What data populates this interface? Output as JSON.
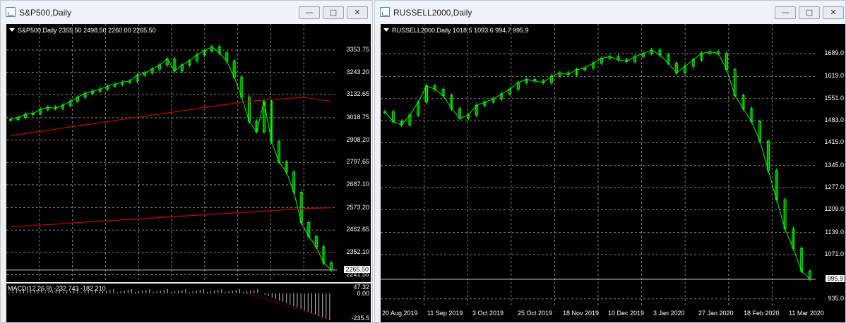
{
  "left_window": {
    "title": "S&P500,Daily",
    "header": "S&P500,Daily  2355.50 2498.50 2260.00 2265.50",
    "macd_label": "MACD(12,26,9) -232.743 -182.210",
    "macd_y_labels": [
      "47.32",
      "0.00",
      "-235.5"
    ],
    "current_price_label": "2265.50",
    "buttons": [
      "minimize",
      "restore",
      "close"
    ]
  },
  "right_window": {
    "title": "RUSSELL2000,Daily",
    "header": "RUSSELL2000,Daily  1018.5 1093.6 994.7 995.9",
    "current_price_label": "995.9",
    "buttons": [
      "minimize",
      "restore",
      "close"
    ]
  },
  "colors": {
    "bull": "#00ff00",
    "bear": "#00ff00",
    "ma": "#d00000",
    "grid": "#808080",
    "background": "#000000"
  },
  "chart_data": [
    {
      "type": "line",
      "title": "S&P500,Daily",
      "ylabel": "",
      "xlabel": "",
      "ylim": [
        2240,
        3420
      ],
      "y_ticks": [
        3353.75,
        3243.2,
        3132.65,
        3018.75,
        2908.2,
        2797.65,
        2687.1,
        2573.2,
        2462.65,
        2352.1,
        2241.55
      ],
      "x": [
        0,
        4,
        8,
        12,
        16,
        20,
        24,
        28,
        32,
        36,
        40,
        44,
        48,
        52,
        56,
        60,
        64,
        68,
        72,
        76,
        80,
        84,
        88,
        92,
        96,
        100,
        104,
        108,
        110,
        112,
        114,
        116,
        118,
        120,
        122,
        124,
        126,
        128,
        130,
        132,
        134,
        136,
        138,
        140
      ],
      "series": [
        {
          "name": "close",
          "values": [
            3010,
            3020,
            3035,
            3040,
            3060,
            3070,
            3065,
            3080,
            3100,
            3120,
            3140,
            3150,
            3160,
            3175,
            3185,
            3195,
            3200,
            3230,
            3240,
            3260,
            3280,
            3310,
            3250,
            3280,
            3300,
            3330,
            3350,
            3370,
            3340,
            3300,
            3220,
            3120,
            3000,
            2950,
            3100,
            2900,
            2800,
            2750,
            2650,
            2500,
            2430,
            2380,
            2300,
            2265
          ]
        },
        {
          "name": "ma_short",
          "values": [
            2930,
            2940,
            2950,
            2960,
            2970,
            2980,
            2990,
            3000,
            3010,
            3020,
            3030,
            3040,
            3050,
            3060,
            3070,
            3080,
            3090,
            3100,
            3105,
            3110,
            3115,
            3120,
            3110,
            3100
          ]
        },
        {
          "name": "ma_long",
          "values": [
            2478,
            2485,
            2492,
            2500,
            2507,
            2514,
            2521,
            2528,
            2535,
            2542,
            2549,
            2556,
            2563,
            2570,
            2573
          ]
        }
      ]
    },
    {
      "type": "line",
      "title": "RUSSELL2000,Daily",
      "ylabel": "",
      "xlabel": "",
      "ylim": [
        930,
        1750
      ],
      "y_ticks": [
        1689.0,
        1619.0,
        1551.0,
        1483.0,
        1415.0,
        1345.0,
        1277.0,
        1209.0,
        1139.0,
        1071.0,
        935.0
      ],
      "categories": [
        "20 Aug 2019",
        "11 Sep 2019",
        "3 Oct 2019",
        "25 Oct 2019",
        "18 Nov 2019",
        "10 Dec 2019",
        "3 Jan 2020",
        "27 Jan 2020",
        "18 Feb 2020",
        "11 Mar 2020"
      ],
      "series": [
        {
          "name": "close",
          "values": [
            1510,
            1480,
            1470,
            1500,
            1540,
            1590,
            1580,
            1560,
            1520,
            1490,
            1500,
            1530,
            1540,
            1550,
            1565,
            1580,
            1600,
            1610,
            1605,
            1600,
            1620,
            1630,
            1625,
            1640,
            1645,
            1660,
            1675,
            1680,
            1670,
            1665,
            1680,
            1690,
            1700,
            1685,
            1660,
            1630,
            1650,
            1670,
            1690,
            1695,
            1690,
            1640,
            1560,
            1520,
            1480,
            1420,
            1330,
            1240,
            1150,
            1090,
            1020,
            995
          ]
        }
      ]
    }
  ]
}
